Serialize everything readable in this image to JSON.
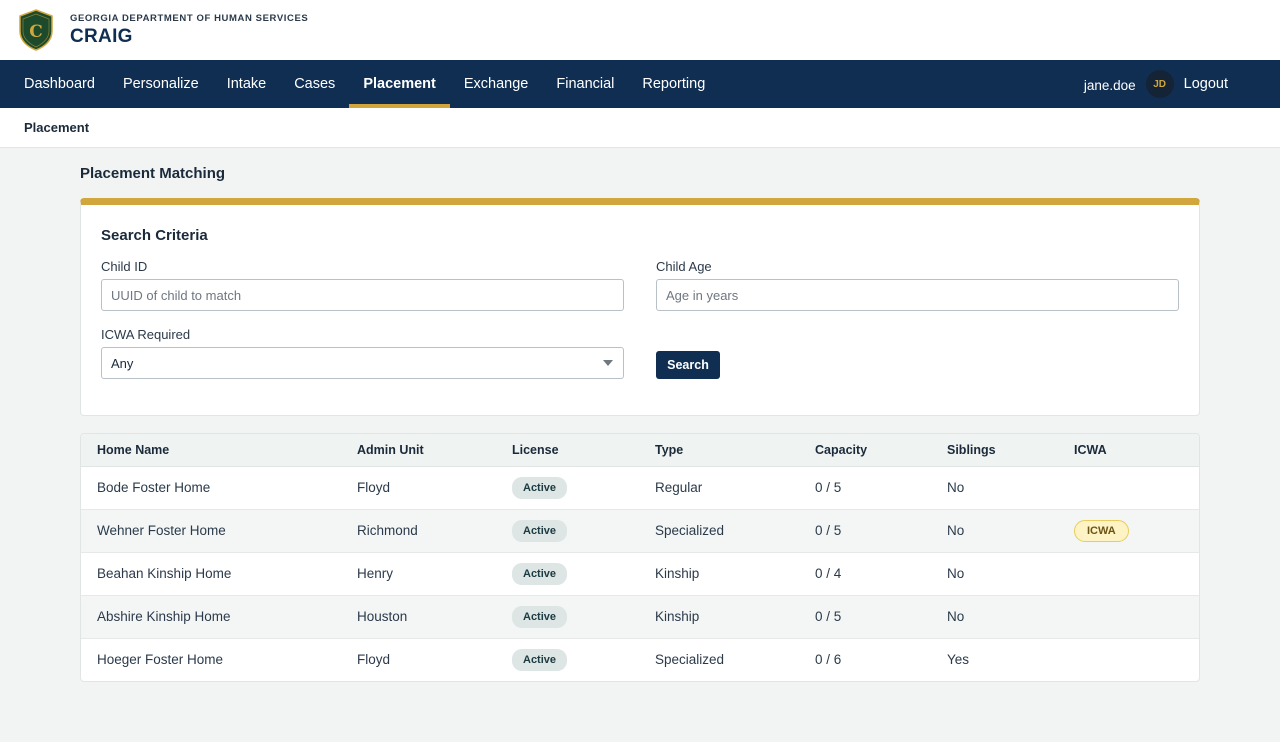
{
  "header": {
    "agency": "GEORGIA DEPARTMENT OF HUMAN SERVICES",
    "app_name": "CRAIG",
    "logo_letter": "C"
  },
  "nav": {
    "items": [
      {
        "label": "Dashboard",
        "active": false
      },
      {
        "label": "Personalize",
        "active": false
      },
      {
        "label": "Intake",
        "active": false
      },
      {
        "label": "Cases",
        "active": false
      },
      {
        "label": "Placement",
        "active": true
      },
      {
        "label": "Exchange",
        "active": false
      },
      {
        "label": "Financial",
        "active": false
      },
      {
        "label": "Reporting",
        "active": false
      }
    ],
    "username": "jane.doe",
    "avatar_initials": "JD",
    "logout_label": "Logout"
  },
  "breadcrumb": "Placement",
  "page_title": "Placement Matching",
  "search": {
    "title": "Search Criteria",
    "child_id_label": "Child ID",
    "child_id_placeholder": "UUID of child to match",
    "child_id_value": "",
    "child_age_label": "Child Age",
    "child_age_placeholder": "Age in years",
    "child_age_value": "",
    "icwa_label": "ICWA Required",
    "icwa_selected": "Any",
    "search_label": "Search"
  },
  "results": {
    "columns": [
      "Home Name",
      "Admin Unit",
      "License",
      "Type",
      "Capacity",
      "Siblings",
      "ICWA"
    ],
    "rows": [
      {
        "home_name": "Bode Foster Home",
        "admin_unit": "Floyd",
        "license": "Active",
        "type": "Regular",
        "capacity": "0 / 5",
        "siblings": "No",
        "icwa": ""
      },
      {
        "home_name": "Wehner Foster Home",
        "admin_unit": "Richmond",
        "license": "Active",
        "type": "Specialized",
        "capacity": "0 / 5",
        "siblings": "No",
        "icwa": "ICWA"
      },
      {
        "home_name": "Beahan Kinship Home",
        "admin_unit": "Henry",
        "license": "Active",
        "type": "Kinship",
        "capacity": "0 / 4",
        "siblings": "No",
        "icwa": ""
      },
      {
        "home_name": "Abshire Kinship Home",
        "admin_unit": "Houston",
        "license": "Active",
        "type": "Kinship",
        "capacity": "0 / 5",
        "siblings": "No",
        "icwa": ""
      },
      {
        "home_name": "Hoeger Foster Home",
        "admin_unit": "Floyd",
        "license": "Active",
        "type": "Specialized",
        "capacity": "0 / 6",
        "siblings": "Yes",
        "icwa": ""
      }
    ]
  },
  "colors": {
    "navy": "#0f2e52",
    "gold": "#d1a73d",
    "logo_green": "#1e4a2c"
  },
  "icons": {
    "logo": "shield-logo-icon",
    "select_caret": "chevron-down-icon"
  }
}
